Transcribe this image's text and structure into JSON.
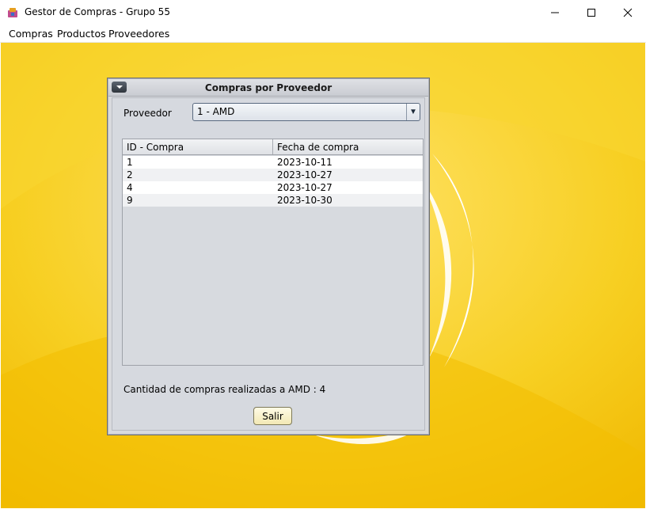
{
  "window": {
    "title": "Gestor de Compras - Grupo 55",
    "icon": "app-icon"
  },
  "menubar": {
    "items": [
      "Compras",
      "Productos",
      "Proveedores"
    ]
  },
  "dialog": {
    "title": "Compras por Proveedor",
    "proveedor_label": "Proveedor",
    "proveedor_selected": "1 - AMD",
    "table": {
      "columns": [
        "ID - Compra",
        "Fecha de compra"
      ],
      "rows": [
        [
          "1",
          "2023-10-11"
        ],
        [
          "2",
          "2023-10-27"
        ],
        [
          "4",
          "2023-10-27"
        ],
        [
          "9",
          "2023-10-30"
        ]
      ]
    },
    "summary": "Cantidad de compras realizadas a AMD : 4",
    "exit_button": "Salir"
  },
  "colors": {
    "desktop_bg": "#f5c400",
    "dialog_bg": "#d6d9df",
    "row_alt": "#f0f1f3"
  }
}
